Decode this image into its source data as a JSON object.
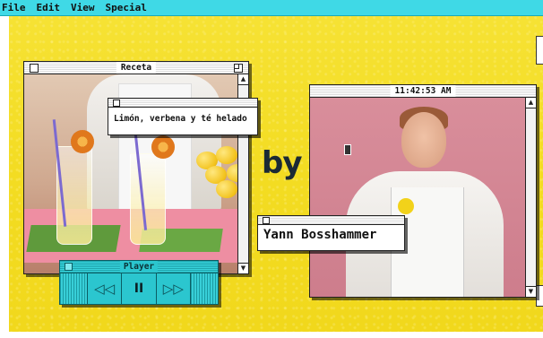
{
  "menubar": {
    "items": [
      "File",
      "Edit",
      "View",
      "Special"
    ]
  },
  "recipe_window": {
    "title": "Receta",
    "label": "Limón, verbena y té helado"
  },
  "player": {
    "title": "Player",
    "rewind_glyph": "◁◁",
    "pause_glyph": "II",
    "forward_glyph": "▷▷"
  },
  "by_text": "by",
  "video_window": {
    "title": "11:42:53 AM",
    "name_label": "Yann Bosshammer"
  },
  "icons": {
    "close": "close-box",
    "zoom": "zoom-box",
    "scroll_up": "scroll-up-arrow",
    "scroll_down": "scroll-down-arrow"
  },
  "colors": {
    "desktop": "#f3dc22",
    "menubar": "#3fd9e6",
    "player": "#2bc6cf"
  }
}
